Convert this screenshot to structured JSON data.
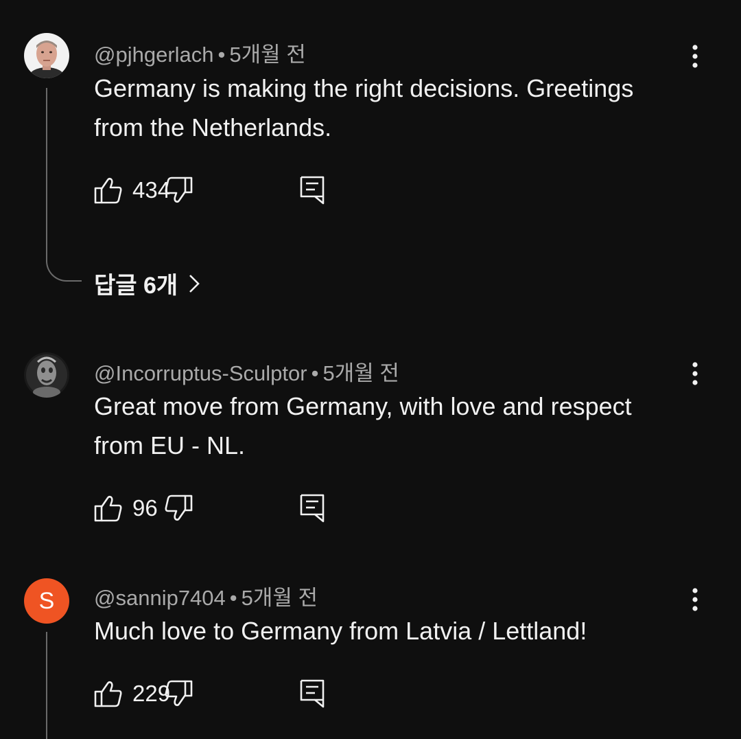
{
  "comments": [
    {
      "handle": "@pjhgerlach",
      "separator": "•",
      "time": "5개월 전",
      "text": "Germany is making the right decisions. Greetings from the Netherlands.",
      "likes": "434",
      "replies_label": "답글 6개"
    },
    {
      "handle": "@Incorruptus-Sculptor",
      "separator": "•",
      "time": "5개월 전",
      "text": "Great move from Germany, with love and respect from EU - NL.",
      "likes": "96"
    },
    {
      "handle": "@sannip7404",
      "separator": "•",
      "time": "5개월 전",
      "text": "Much love to Germany from Latvia / Lettland!",
      "likes": "229",
      "avatar_letter": "S",
      "avatar_color": "#ef5423"
    }
  ],
  "icons": {
    "like": "thumbs-up-icon",
    "dislike": "thumbs-down-icon",
    "reply": "reply-comment-icon",
    "more": "more-vertical-icon",
    "chevron": "chevron-right-icon"
  }
}
